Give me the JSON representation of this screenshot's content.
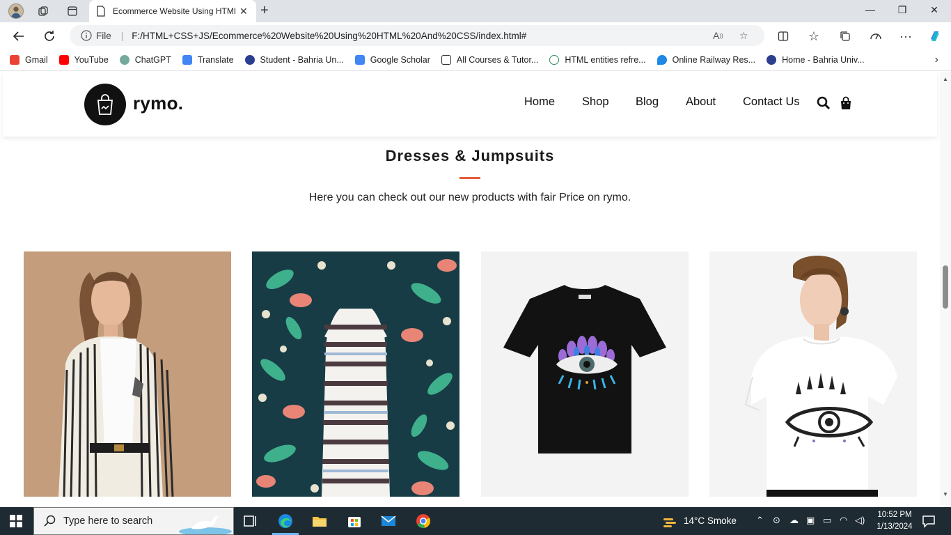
{
  "browser": {
    "tab_title": "Ecommerce Website Using HTML",
    "url_scheme": "File",
    "url": "F:/HTML+CSS+JS/Ecommerce%20Website%20Using%20HTML%20And%20CSS/index.html#",
    "bookmarks": [
      {
        "label": "Gmail",
        "icon": "gmail-icon",
        "color": "#ea4335"
      },
      {
        "label": "YouTube",
        "icon": "youtube-icon",
        "color": "#ff0000"
      },
      {
        "label": "ChatGPT",
        "icon": "chatgpt-icon",
        "color": "#74aa9c"
      },
      {
        "label": "Translate",
        "icon": "translate-icon",
        "color": "#4285f4"
      },
      {
        "label": "Student - Bahria Un...",
        "icon": "bahria-icon",
        "color": "#2c3e8f"
      },
      {
        "label": "Google Scholar",
        "icon": "scholar-icon",
        "color": "#4285f4"
      },
      {
        "label": "All Courses & Tutor...",
        "icon": "courses-icon",
        "color": "#333333"
      },
      {
        "label": "HTML entities refre...",
        "icon": "help-icon",
        "color": "#2e8b57"
      },
      {
        "label": "Online Railway Res...",
        "icon": "railway-icon",
        "color": "#1e88e5"
      },
      {
        "label": "Home - Bahria Univ...",
        "icon": "bahria-icon",
        "color": "#2c3e8f"
      }
    ]
  },
  "site": {
    "logo": "rymo.",
    "nav": [
      "Home",
      "Shop",
      "Blog",
      "About",
      "Contact Us"
    ],
    "accent_color": "#e35f3d"
  },
  "section": {
    "title": "Dresses & Jumpsuits",
    "subtitle": "Here you can check out our new products with fair Price on rymo."
  },
  "products": [
    {
      "image": "striped-blazer-model"
    },
    {
      "image": "striped-dress-floral"
    },
    {
      "image": "black-tshirt-eye"
    },
    {
      "image": "white-tshirt-model"
    }
  ],
  "taskbar": {
    "search_placeholder": "Type here to search",
    "weather": "14°C  Smoke",
    "time": "10:52 PM",
    "date": "1/13/2024"
  }
}
